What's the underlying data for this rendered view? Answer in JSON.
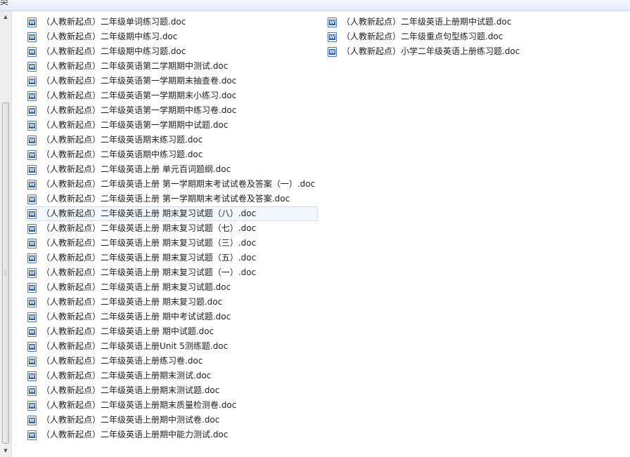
{
  "header": {
    "label": "类"
  },
  "files": {
    "left": [
      "（人教新起点）二年级单词练习题.doc",
      "（人教新起点）二年级期中练习.doc",
      "（人教新起点）二年级期中练习题.doc",
      "（人教新起点）二年级英语第二学期期中测试.doc",
      "（人教新起点）二年级英语第一学期期末抽查卷.doc",
      "（人教新起点）二年级英语第一学期期末小练习.doc",
      "（人教新起点）二年级英语第一学期期中练习卷.doc",
      "（人教新起点）二年级英语第一学期期中试题.doc",
      "（人教新起点）二年级英语期末练习题.doc",
      "（人教新起点）二年级英语期中练习题.doc",
      "（人教新起点）二年级英语上册 单元百词题纲.doc",
      "（人教新起点）二年级英语上册 第一学期期末考试试卷及答案（一）.doc",
      "（人教新起点）二年级英语上册 第一学期期末考试试卷及答案.doc",
      "（人教新起点）二年级英语上册 期末复习试题（八）.doc",
      "（人教新起点）二年级英语上册 期末复习试题（七）.doc",
      "（人教新起点）二年级英语上册 期末复习试题（三）.doc",
      "（人教新起点）二年级英语上册 期末复习试题（五）.doc",
      "（人教新起点）二年级英语上册 期末复习试题（一）.doc",
      "（人教新起点）二年级英语上册 期末复习试题.doc",
      "（人教新起点）二年级英语上册 期末复习题.doc",
      "（人教新起点）二年级英语上册 期中考试试题.doc",
      "（人教新起点）二年级英语上册 期中试题.doc",
      "（人教新起点）二年级英语上册Unit 5测练题.doc",
      "（人教新起点）二年级英语上册练习卷.doc",
      "（人教新起点）二年级英语上册期末测试.doc",
      "（人教新起点）二年级英语上册期末测试题.doc",
      "（人教新起点）二年级英语上册期末质量检测卷.doc",
      "（人教新起点）二年级英语上册期中测试卷.doc",
      "（人教新起点）二年级英语上册期中能力测试.doc"
    ],
    "right": [
      "（人教新起点）二年级英语上册期中试题.doc",
      "（人教新起点）二年级重点句型练习题.doc",
      "（人教新起点）小学二年级英语上册练习题.doc"
    ],
    "selected_left_index": 13
  },
  "icons": {
    "file": "word-doc-icon",
    "scroll_up": "arrow-up-icon",
    "scroll_down": "arrow-down-icon"
  }
}
